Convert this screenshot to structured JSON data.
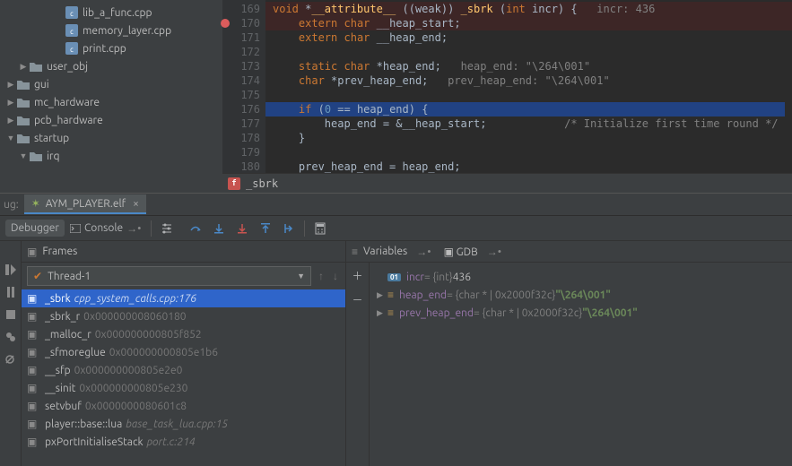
{
  "tree": {
    "items": [
      {
        "indent": 60,
        "icon": "cpp",
        "label": "lib_a_func.cpp"
      },
      {
        "indent": 60,
        "icon": "cpp",
        "label": "memory_layer.cpp"
      },
      {
        "indent": 60,
        "icon": "cpp",
        "label": "print.cpp"
      },
      {
        "indent": 20,
        "arrow": "▶",
        "icon": "folder",
        "label": "user_obj"
      },
      {
        "indent": 6,
        "arrow": "▶",
        "icon": "folder",
        "label": "gui"
      },
      {
        "indent": 6,
        "arrow": "▶",
        "icon": "folder",
        "label": "mc_hardware"
      },
      {
        "indent": 6,
        "arrow": "▶",
        "icon": "folder",
        "label": "pcb_hardware"
      },
      {
        "indent": 6,
        "arrow": "▼",
        "icon": "folder",
        "label": "startup"
      },
      {
        "indent": 20,
        "arrow": "▼",
        "icon": "folder",
        "label": "irq"
      }
    ]
  },
  "editor": {
    "lines": [
      {
        "n": 169,
        "hl": "red",
        "html": "<span class='kw'>void</span> *<span class='fn'>__attribute__</span> ((weak)) <span class='fn'>_sbrk</span> (<span class='kw'>int</span> incr) {   <span class='cmt'>incr: 436</span>"
      },
      {
        "n": 170,
        "bp": true,
        "hl": "red",
        "html": "    <span class='kw'>extern</span> <span class='kw'>char</span> __heap_start;"
      },
      {
        "n": 171,
        "html": "    <span class='kw'>extern</span> <span class='kw'>char</span> __heap_end;"
      },
      {
        "n": 172,
        "html": ""
      },
      {
        "n": 173,
        "html": "    <span class='kw'>static</span> <span class='kw'>char</span> *heap_end;   <span class='cmt'>heap_end: \"\\264\\001\"</span>"
      },
      {
        "n": 174,
        "html": "    <span class='kw'>char</span> *prev_heap_end;   <span class='cmt'>prev_heap_end: \"\\264\\001\"</span>"
      },
      {
        "n": 175,
        "html": ""
      },
      {
        "n": 176,
        "hl": "blue",
        "html": "    <span class='kw'>if</span> (<span class='num'>0</span> == heap_end) {"
      },
      {
        "n": 177,
        "html": "        heap_end = &amp;__heap_start;            <span class='cmt'>/* Initialize first time round */</span>"
      },
      {
        "n": 178,
        "html": "    }"
      },
      {
        "n": 179,
        "html": ""
      },
      {
        "n": 180,
        "html": "    prev_heap_end = heap_end;"
      }
    ],
    "breadcrumb": "_sbrk"
  },
  "tabbar": {
    "prefix": "ug:",
    "tab_label": "AYM_PLAYER.elf"
  },
  "toolbar": {
    "debugger": "Debugger",
    "console": "Console"
  },
  "frames": {
    "title": "Frames",
    "thread": "Thread-1",
    "items": [
      {
        "name": "_sbrk",
        "loc": "cpp_system_calls.cpp:176",
        "sel": true
      },
      {
        "name": "_sbrk_r",
        "addr": "0x000000008060180"
      },
      {
        "name": "_malloc_r",
        "addr": "0x000000000805f852"
      },
      {
        "name": "_sfmoreglue",
        "addr": "0x000000000805e1b6"
      },
      {
        "name": "__sfp",
        "addr": "0x000000000805e2e0"
      },
      {
        "name": "__sinit",
        "addr": "0x000000000805e230"
      },
      {
        "name": "setvbuf",
        "addr": "0x0000000080601c8"
      },
      {
        "name": "player::base::lua",
        "loc": "base_task_lua.cpp:15"
      },
      {
        "name": "pxPortInitialiseStack",
        "loc": "port.c:214"
      }
    ]
  },
  "vars": {
    "variables_label": "Variables",
    "gdb_label": "GDB",
    "items": [
      {
        "tri": "",
        "badge": "01",
        "name": "incr",
        "type": "{int}",
        "val": "436"
      },
      {
        "tri": "▶",
        "badge": "P",
        "name": "heap_end",
        "type": "{char * | 0x2000f32c}",
        "str": "\"\\264\\001\""
      },
      {
        "tri": "▶",
        "badge": "P",
        "name": "prev_heap_end",
        "type": "{char * | 0x2000f32c}",
        "str": "\"\\264\\001\""
      }
    ]
  }
}
